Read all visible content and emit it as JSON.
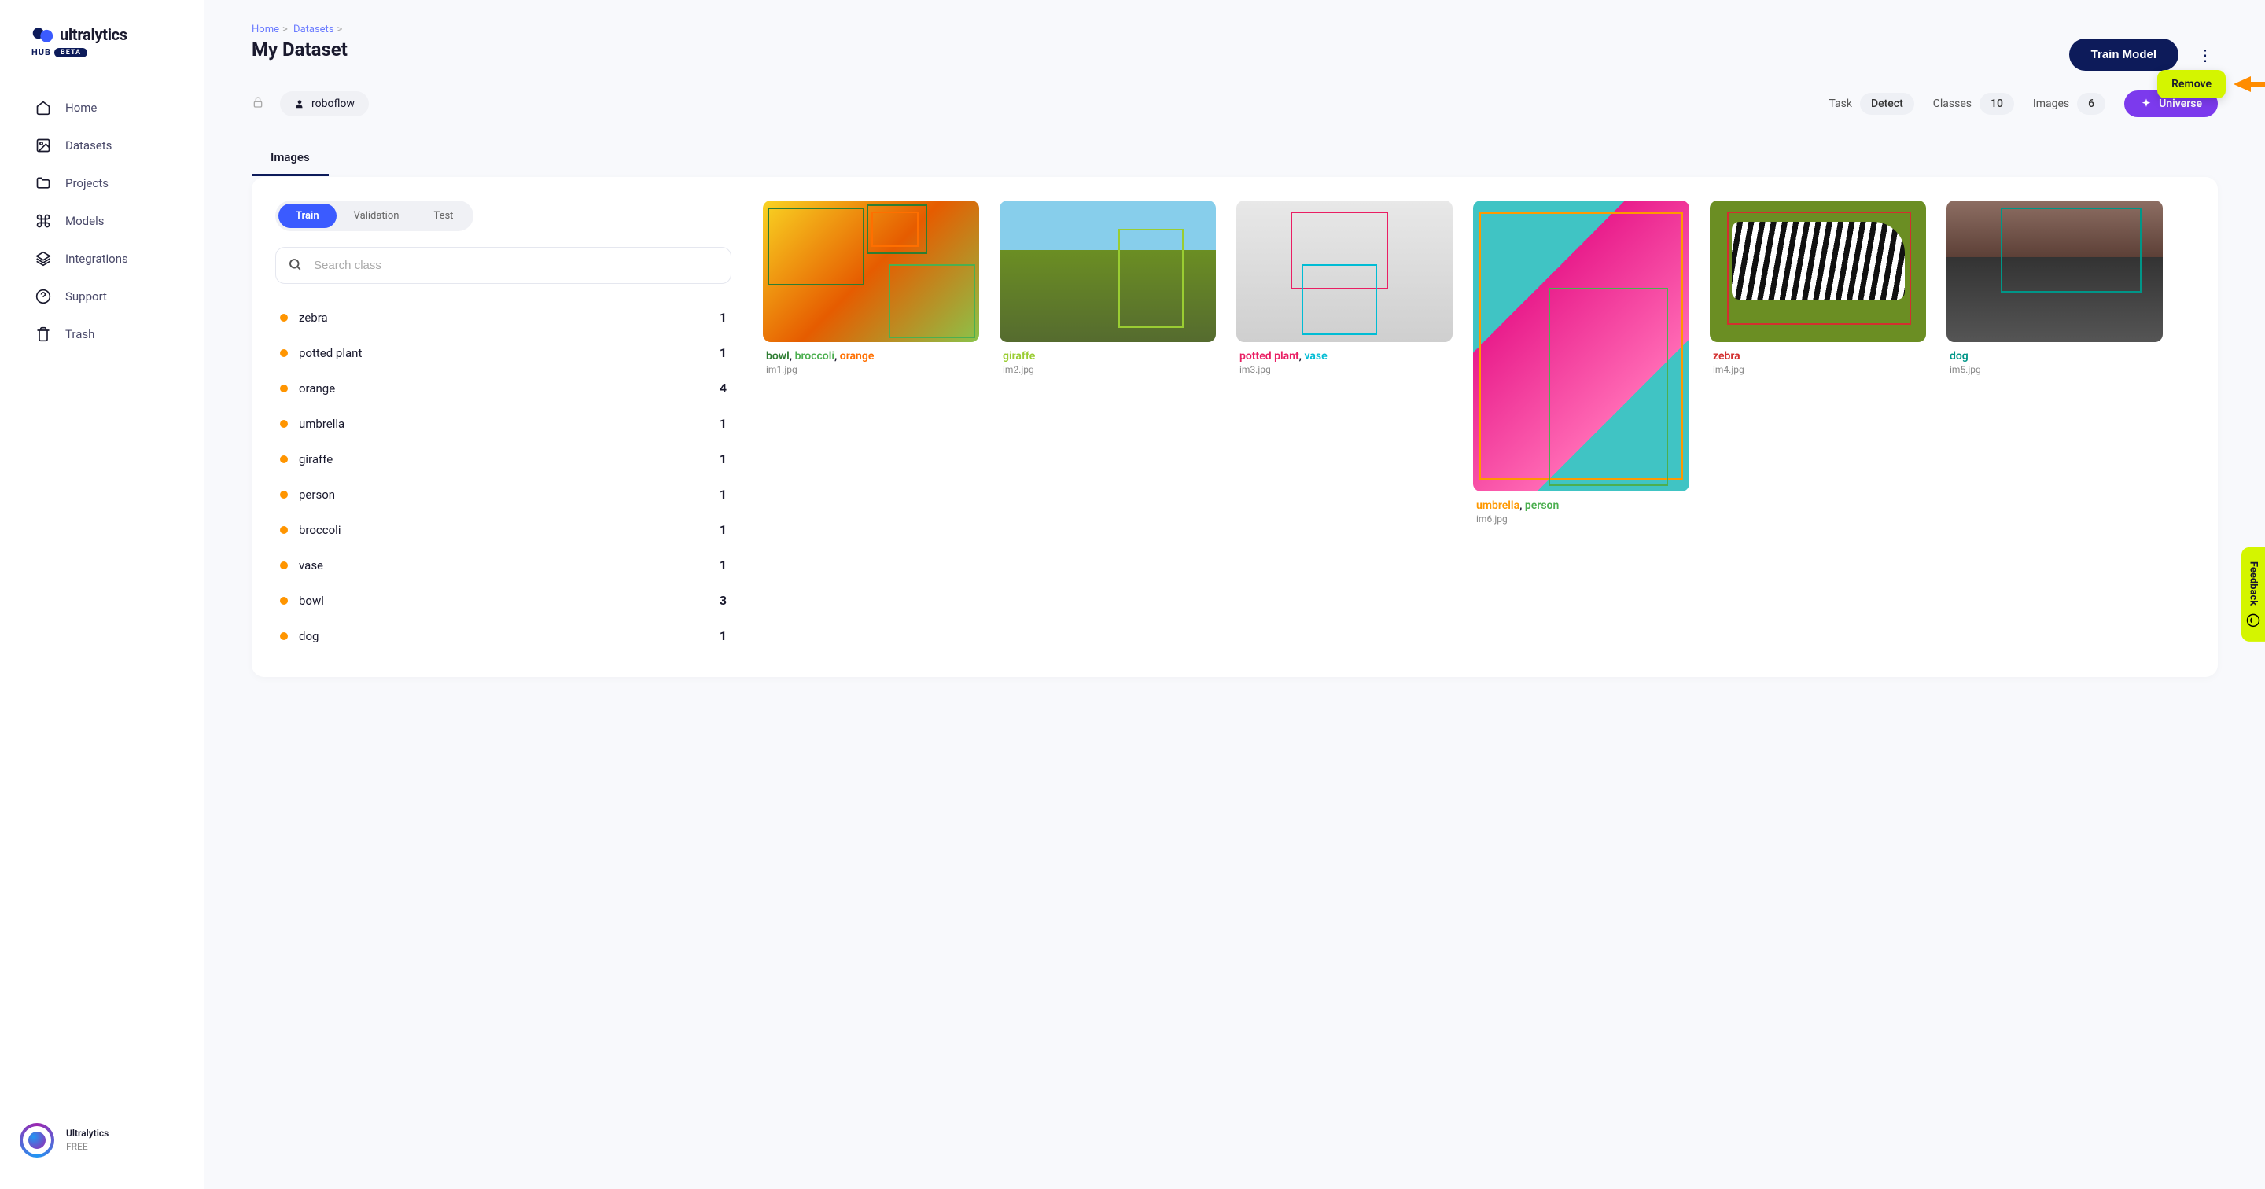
{
  "brand": {
    "name": "ultralytics",
    "sub": "HUB",
    "badge": "BETA"
  },
  "nav": {
    "home": "Home",
    "datasets": "Datasets",
    "projects": "Projects",
    "models": "Models",
    "integrations": "Integrations",
    "support": "Support",
    "trash": "Trash"
  },
  "user": {
    "name": "Ultralytics",
    "plan": "FREE"
  },
  "breadcrumb": {
    "home": "Home",
    "datasets": "Datasets"
  },
  "page": {
    "title": "My Dataset"
  },
  "actions": {
    "train": "Train Model",
    "remove": "Remove"
  },
  "meta": {
    "owner": "roboflow",
    "task_label": "Task",
    "task_value": "Detect",
    "classes_label": "Classes",
    "classes_value": "10",
    "images_label": "Images",
    "images_value": "6",
    "universe": "Universe"
  },
  "tabs": {
    "images": "Images"
  },
  "splits": {
    "train": "Train",
    "validation": "Validation",
    "test": "Test"
  },
  "search": {
    "placeholder": "Search class"
  },
  "classes": [
    {
      "name": "zebra",
      "count": "1"
    },
    {
      "name": "potted plant",
      "count": "1"
    },
    {
      "name": "orange",
      "count": "4"
    },
    {
      "name": "umbrella",
      "count": "1"
    },
    {
      "name": "giraffe",
      "count": "1"
    },
    {
      "name": "person",
      "count": "1"
    },
    {
      "name": "broccoli",
      "count": "1"
    },
    {
      "name": "vase",
      "count": "1"
    },
    {
      "name": "bowl",
      "count": "3"
    },
    {
      "name": "dog",
      "count": "1"
    }
  ],
  "cards": {
    "c1": {
      "file": "im1.jpg",
      "l1": "bowl",
      "l2": "broccoli",
      "l3": "orange",
      "sep": ", "
    },
    "c2": {
      "file": "im2.jpg",
      "l1": "giraffe"
    },
    "c3": {
      "file": "im3.jpg",
      "l1": "potted plant",
      "l2": "vase",
      "sep": ", "
    },
    "c4": {
      "file": "im6.jpg",
      "l1": "umbrella",
      "l2": "person",
      "sep": ", "
    },
    "c5": {
      "file": "im4.jpg",
      "l1": "zebra"
    },
    "c6": {
      "file": "im5.jpg",
      "l1": "dog"
    }
  },
  "feedback": "Feedback"
}
